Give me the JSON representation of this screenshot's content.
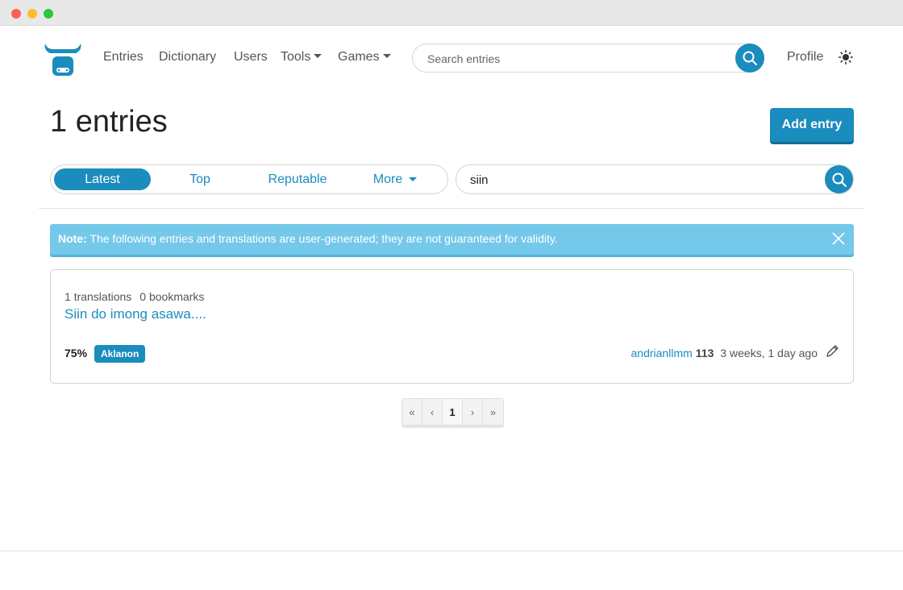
{
  "nav": {
    "links": [
      {
        "label": "Entries"
      },
      {
        "label": "Dictionary"
      },
      {
        "label": "Users"
      },
      {
        "label": "Tools"
      },
      {
        "label": "Games"
      }
    ],
    "search_placeholder": "Search entries",
    "profile_label": "Profile",
    "theme_icon": "sun-icon"
  },
  "header": {
    "title": "1 entries",
    "add_entry_label": "Add entry"
  },
  "tabs": [
    {
      "label": "Latest",
      "active": true
    },
    {
      "label": "Top",
      "active": false
    },
    {
      "label": "Reputable",
      "active": false
    },
    {
      "label": "More",
      "active": false
    }
  ],
  "filter_search": {
    "value": "siin"
  },
  "alert": {
    "strong": "Note:",
    "text": " The following entries and translations are user-generated; they are not guaranteed for validity."
  },
  "entries": [
    {
      "translations": "1 translations",
      "bookmarks": "0 bookmarks",
      "title": "Siin do imong asawa....",
      "percent": "75%",
      "language": "Aklanon",
      "author": "andrianllmm",
      "reputation": "113",
      "time": "3 weeks, 1 day ago"
    }
  ],
  "pagination": {
    "first": "«",
    "prev": "‹",
    "current": "1",
    "next": "›",
    "last": "»"
  },
  "colors": {
    "accent": "#1a8cbd",
    "alert_bg": "#74c8ea"
  }
}
